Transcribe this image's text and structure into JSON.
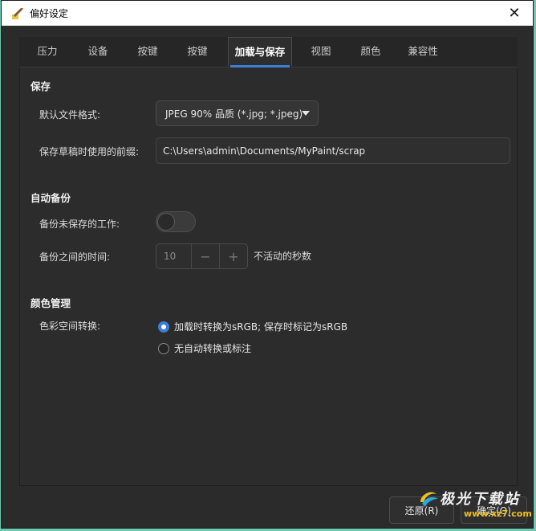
{
  "window": {
    "title": "偏好设定",
    "close_glyph": "✕"
  },
  "tabs": [
    {
      "label": "压力",
      "active": false
    },
    {
      "label": "设备",
      "active": false
    },
    {
      "label": "按键",
      "active": false
    },
    {
      "label": "按键",
      "active": false
    },
    {
      "label": "加载与保存",
      "active": true
    },
    {
      "label": "视图",
      "active": false
    },
    {
      "label": "颜色",
      "active": false
    },
    {
      "label": "兼容性",
      "active": false
    }
  ],
  "save": {
    "section_title": "保存",
    "format_label": "默认文件格式:",
    "format_value": "JPEG 90% 品质 (*.jpg; *.jpeg)",
    "prefix_label": "保存草稿时使用的前缀:",
    "prefix_value": "C:\\Users\\admin\\Documents/MyPaint/scrap"
  },
  "autosave": {
    "section_title": "自动备份",
    "toggle_label": "备份未保存的工作:",
    "toggle_on": false,
    "interval_label": "备份之间的时间:",
    "interval_value": "10",
    "minus_glyph": "−",
    "plus_glyph": "+",
    "interval_suffix": "不活动的秒数"
  },
  "color_management": {
    "section_title": "颜色管理",
    "conversion_label": "色彩空间转换:",
    "options": [
      {
        "label": "加载时转换为sRGB; 保存时标记为sRGB",
        "checked": true
      },
      {
        "label": "无自动转换或标注",
        "checked": false
      }
    ]
  },
  "footer": {
    "revert_label": "还原(R)",
    "ok_label": "确定(O)"
  },
  "watermark": {
    "text": "极光下载站",
    "url": "www.xz7.com"
  },
  "colors": {
    "accent": "#3d7fd6",
    "background": "#2b2b2b",
    "panel": "#2c2c2c"
  }
}
